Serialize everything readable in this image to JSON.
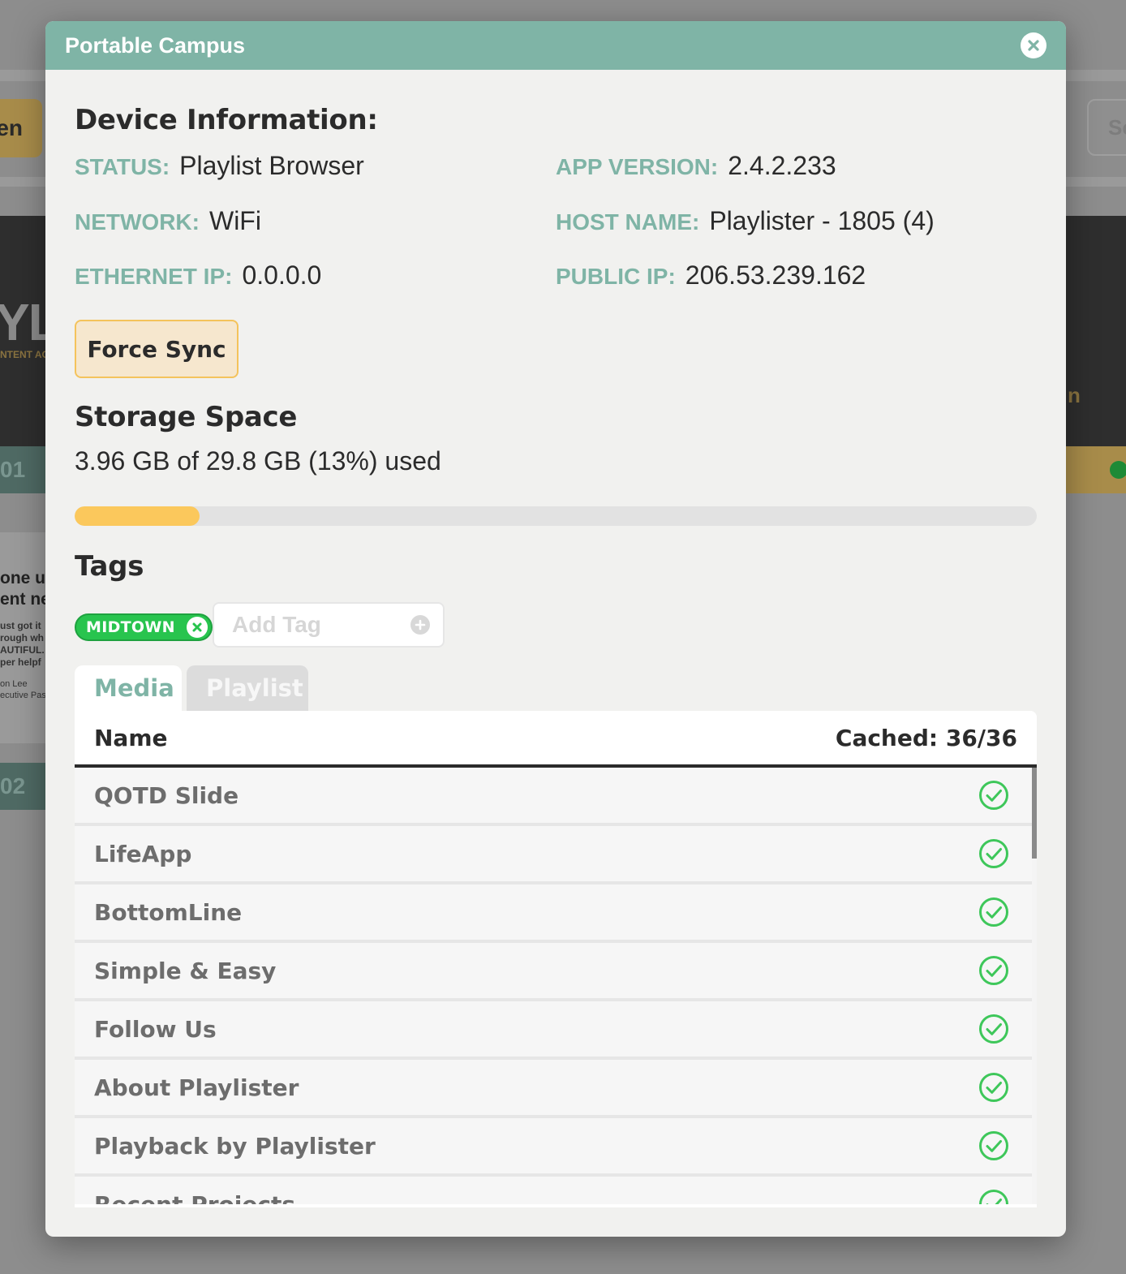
{
  "background": {
    "left_button": "en",
    "right_button": "Sc",
    "logo": "YL",
    "logo_sub": "NTENT AC",
    "dark_right": "n",
    "row1": "01",
    "row2": "02",
    "card_title": "one us\nent ne",
    "card_body": "ust got it\nrough wh\nAUTIFUL.\nper helpf",
    "card_author": "on Lee\necutive Pas"
  },
  "modal": {
    "title": "Portable Campus",
    "close_icon": "close-icon"
  },
  "device": {
    "heading": "Device Information:",
    "status": {
      "label": "STATUS:",
      "value": "Playlist Browser"
    },
    "app_version": {
      "label": "APP VERSION:",
      "value": "2.4.2.233"
    },
    "network": {
      "label": "NETWORK:",
      "value": "WiFi"
    },
    "host_name": {
      "label": "HOST NAME:",
      "value": "Playlister - 1805 (4)"
    },
    "ethernet_ip": {
      "label": "ETHERNET IP:",
      "value": "0.0.0.0"
    },
    "public_ip": {
      "label": "PUBLIC IP:",
      "value": "206.53.239.162"
    },
    "force_sync_label": "Force Sync"
  },
  "storage": {
    "heading": "Storage Space",
    "summary": "3.96 GB of 29.8 GB (13%) used",
    "used_fraction": 0.13
  },
  "tags": {
    "heading": "Tags",
    "items": [
      "MIDTOWN"
    ],
    "add_placeholder": "Add Tag"
  },
  "tabs": [
    {
      "label": "Media",
      "active": true
    },
    {
      "label": "Playlist",
      "active": false
    }
  ],
  "media_table": {
    "col_name": "Name",
    "col_cached": "Cached: 36/36",
    "rows": [
      "QOTD Slide",
      "LifeApp",
      "BottomLine",
      "Simple & Easy",
      "Follow Us",
      "About Playlister",
      "Playback by Playlister",
      "Recent Projects"
    ]
  },
  "colors": {
    "accent": "#7fb4a6",
    "progress": "#fbc85c",
    "tag_green": "#28c44e",
    "check_green": "#3ec75a"
  }
}
